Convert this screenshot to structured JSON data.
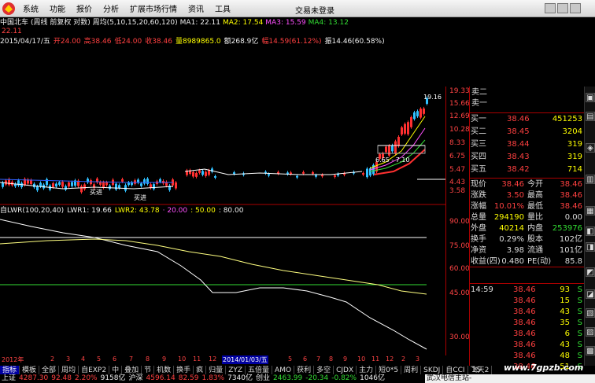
{
  "menu": {
    "items": [
      "系统",
      "功能",
      "报价",
      "分析",
      "扩展市场行情",
      "资讯",
      "工具"
    ],
    "user": "交易未登录"
  },
  "header": {
    "stock": "中国北车",
    "params": "(周线 前复权 对数) 周均(5,10,15,20,60,120)",
    "ma1": "MA1: 22.11",
    "ma2": "MA2: 17.54",
    "ma3": "MA3: 15.59",
    "ma4": "MA4: 13.12",
    "ma5": "22.11"
  },
  "bar_info": {
    "date": "2015/04/17/五",
    "open": "开24.00",
    "high": "高38.46",
    "low": "低24.00",
    "close": "收38.46",
    "vol": "量8989865.0",
    "amount": "额268.9亿",
    "change": "幅14.59(61.12%)",
    "turnover": "振14.46(60.58%)"
  },
  "lwr": {
    "title": "自LWR(100,20,40)",
    "lwr1": "LWR1: 19.66",
    "lwr2": "LWR2: 43.78",
    "l20": "· 20.00",
    "l50": ": 50.00",
    "l80": ": 80.00"
  },
  "price_axis": [
    "19.33",
    "15.66",
    "12.69",
    "10.28",
    "8.33",
    "6.75",
    "5.47",
    "4.43",
    "3.58"
  ],
  "lwr_axis": [
    "90.00",
    "75.00",
    "60.00",
    "45.00",
    "30.00"
  ],
  "chart_labels": {
    "high": "19.16",
    "box": "6.65 - 7.10",
    "buy1": "买进",
    "buy2": "买进",
    "cycle": "周线"
  },
  "x_axis": [
    "2012年",
    "2",
    "3",
    "4",
    "5",
    "6",
    "7",
    "8",
    "9",
    "10",
    "11",
    "12",
    "2014/01/03/五",
    "5",
    "6",
    "7",
    "8",
    "9",
    "10",
    "11",
    "12",
    "2",
    "3"
  ],
  "orderbook": {
    "asks": [
      {
        "label": "卖二",
        "price": "",
        "vol": ""
      },
      {
        "label": "卖一",
        "price": "",
        "vol": ""
      }
    ],
    "bids": [
      {
        "label": "买一",
        "price": "38.46",
        "vol": "451253"
      },
      {
        "label": "买二",
        "price": "38.45",
        "vol": "3204"
      },
      {
        "label": "买三",
        "price": "38.44",
        "vol": "319"
      },
      {
        "label": "买四",
        "price": "38.43",
        "vol": "319"
      },
      {
        "label": "买五",
        "price": "38.42",
        "vol": "714"
      }
    ]
  },
  "quote": [
    {
      "l1": "现价",
      "v1": "38.46",
      "l2": "今开",
      "v2": "38.46"
    },
    {
      "l1": "涨跌",
      "v1": "3.50",
      "l2": "最高",
      "v2": "38.46"
    },
    {
      "l1": "涨幅",
      "v1": "10.01%",
      "l2": "最低",
      "v2": "38.46"
    },
    {
      "l1": "总量",
      "v1": "294190",
      "l2": "量比",
      "v2": "0.00"
    },
    {
      "l1": "外盘",
      "v1": "40214",
      "l2": "内盘",
      "v2": "253976"
    },
    {
      "l1": "换手",
      "v1": "0.29%",
      "l2": "股本",
      "v2": "102亿"
    },
    {
      "l1": "净资",
      "v1": "3.98",
      "l2": "流通",
      "v2": "101亿"
    },
    {
      "l1": "收益(四)",
      "v1": "0.480",
      "l2": "PE(动)",
      "v2": "85.8"
    }
  ],
  "trades": [
    {
      "time": "14:59",
      "price": "38.46",
      "vol": "93",
      "side": "S"
    },
    {
      "time": "",
      "price": "38.46",
      "vol": "15",
      "side": "S"
    },
    {
      "time": "",
      "price": "38.46",
      "vol": "43",
      "side": "S"
    },
    {
      "time": "",
      "price": "38.46",
      "vol": "35",
      "side": "S"
    },
    {
      "time": "",
      "price": "38.46",
      "vol": "6",
      "side": "S"
    },
    {
      "time": "",
      "price": "38.46",
      "vol": "43",
      "side": "S"
    },
    {
      "time": "",
      "price": "38.46",
      "vol": "48",
      "side": "S"
    },
    {
      "time": "",
      "price": "38.46",
      "vol": "51",
      "side": "S"
    }
  ],
  "tabs": [
    "指标",
    "模板",
    "全部",
    "周均",
    "自EXP2",
    "中",
    "叠加",
    "节",
    "机数",
    "换手",
    "疯",
    "归量",
    "ZYZ",
    "五倍量",
    "AMO",
    "获利",
    "多空",
    "CJDX",
    "主力",
    "短0*5",
    "周利",
    "SKDJ",
    "自CCI",
    "飞天2"
  ],
  "tabs2": [
    "扩展A",
    "关联报价"
  ],
  "ticker": {
    "sh_label": "上证",
    "sh": "4287.30",
    "sh_chg": "92.48",
    "sh_pct": "2.20%",
    "sh_amt": "9158亿",
    "hs_label": "沪深",
    "hs": "4596.14",
    "hs_chg": "82.59",
    "hs_pct": "1.83%",
    "hs_amt": "7340亿",
    "cy_label": "创业",
    "cy": "2463.99",
    "cy_chg": "-20.34",
    "cy_pct": "-0.82%",
    "cy_amt": "1046亿",
    "right": "武汉电信主站-"
  },
  "right_num": "15",
  "watermark": "www.7gpzb.com",
  "colors": {
    "up": "#ff4040",
    "down": "#33dd33",
    "bg": "#000000",
    "axis": "#a00000",
    "hl": "#0000a0"
  }
}
